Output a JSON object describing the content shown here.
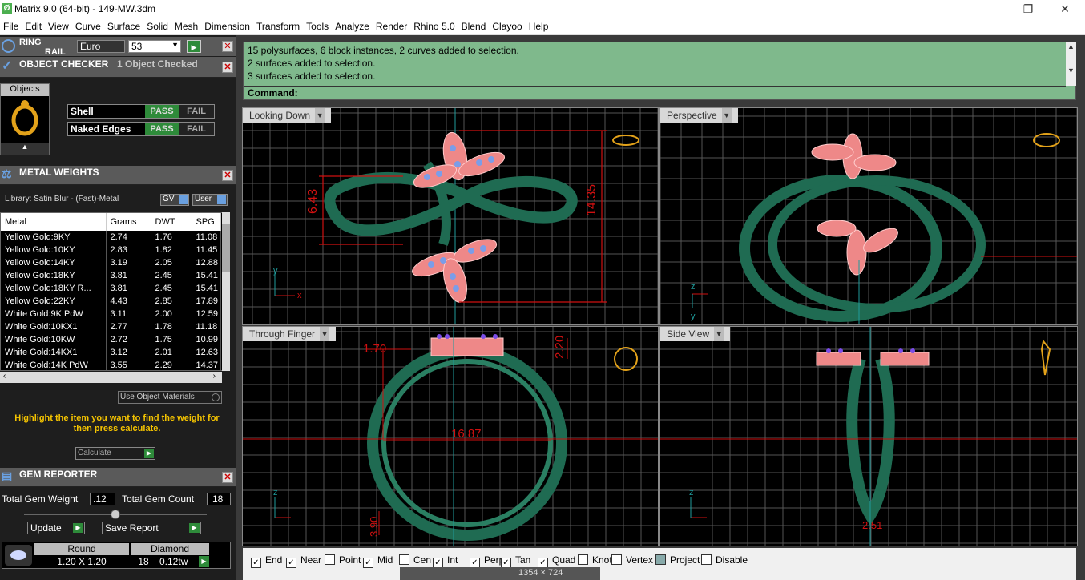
{
  "window": {
    "title": "Matrix 9.0 (64-bit) - 149-MW.3dm",
    "app_icon": "matrix-icon",
    "minimize": "—",
    "maximize": "❐",
    "close": "✕"
  },
  "menu": [
    "File",
    "Edit",
    "View",
    "Curve",
    "Surface",
    "Solid",
    "Mesh",
    "Dimension",
    "Transform",
    "Tools",
    "Analyze",
    "Render",
    "Rhino 5.0",
    "Blend",
    "Clayoo",
    "Help"
  ],
  "ring_rail": {
    "label1": "RING",
    "label2": "RAIL",
    "size_system": "Euro",
    "size_value": "53"
  },
  "object_checker": {
    "title": "OBJECT CHECKER",
    "status": "1 Object Checked",
    "objects_label": "Objects",
    "checks": [
      {
        "name": "Shell",
        "pass": "PASS",
        "fail": "FAIL"
      },
      {
        "name": "Naked Edges",
        "pass": "PASS",
        "fail": "FAIL"
      }
    ]
  },
  "metal_weights": {
    "title": "METAL WEIGHTS",
    "library": "Library: Satin Blur - (Fast)-Metal",
    "gv": "GV",
    "user": "User",
    "columns": [
      "Metal",
      "Grams",
      "DWT",
      "SPG"
    ],
    "rows": [
      [
        "Yellow Gold:9KY",
        "2.74",
        "1.76",
        "11.08"
      ],
      [
        "Yellow Gold:10KY",
        "2.83",
        "1.82",
        "11.45"
      ],
      [
        "Yellow Gold:14KY",
        "3.19",
        "2.05",
        "12.88"
      ],
      [
        "Yellow Gold:18KY",
        "3.81",
        "2.45",
        "15.41"
      ],
      [
        "Yellow Gold:18KY R...",
        "3.81",
        "2.45",
        "15.41"
      ],
      [
        "Yellow Gold:22KY",
        "4.43",
        "2.85",
        "17.89"
      ],
      [
        "White Gold:9K PdW",
        "3.11",
        "2.00",
        "12.59"
      ],
      [
        "White Gold:10KX1",
        "2.77",
        "1.78",
        "11.18"
      ],
      [
        "White Gold:10KW",
        "2.72",
        "1.75",
        "10.99"
      ],
      [
        "White Gold:14KX1",
        "3.12",
        "2.01",
        "12.63"
      ],
      [
        "White Gold:14K PdW",
        "3.55",
        "2.29",
        "14.37"
      ]
    ],
    "use_object_materials": "Use Object Materials",
    "hint": "Highlight the item you want to find the weight for then press calculate.",
    "calculate": "Calculate"
  },
  "gem_reporter": {
    "title": "GEM REPORTER",
    "total_weight_label": "Total Gem Weight",
    "total_weight": ".12",
    "total_count_label": "Total Gem Count",
    "total_count": "18",
    "update": "Update",
    "save_report": "Save Report",
    "cut_header": "Round",
    "cut_size": "1.20 X 1.20",
    "count": "18",
    "material_header": "Diamond",
    "carat": "0.12tw"
  },
  "command": {
    "lines": [
      "15 polysurfaces, 6 block instances, 2 curves added to selection.",
      "2 surfaces added to selection.",
      "3 surfaces added to selection."
    ],
    "prompt": "Command:"
  },
  "viewports": {
    "top": "Looking Down",
    "persp": "Perspective",
    "front": "Through Finger",
    "side": "Side View"
  },
  "dims": {
    "d1": "6.43",
    "d2": "14.35",
    "d3": "1.70",
    "d4": "2.20",
    "d5": "16.87",
    "d6": "3.90",
    "d7": "2.51"
  },
  "axes": {
    "x": "x",
    "y": "y",
    "z": "z"
  },
  "snaps": [
    {
      "label": "End",
      "on": true
    },
    {
      "label": "Near",
      "on": true
    },
    {
      "label": "Point",
      "on": false
    },
    {
      "label": "Mid",
      "on": true
    },
    {
      "label": "Cen",
      "on": false
    },
    {
      "label": "Int",
      "on": true
    },
    {
      "label": "Perp",
      "on": true
    },
    {
      "label": "Tan",
      "on": true
    },
    {
      "label": "Quad",
      "on": true
    },
    {
      "label": "Knot",
      "on": false
    },
    {
      "label": "Vertex",
      "on": false
    },
    {
      "label": "Project",
      "on": false
    },
    {
      "label": "Disable",
      "on": false
    }
  ],
  "screen_size": "1354 × 724",
  "colors": {
    "panel_bg": "#1e1e1e",
    "command_bg": "#7fb98c",
    "ring_green": "#1f6b52",
    "pass_green": "#2e8b3a",
    "dim_red": "#d01010"
  }
}
